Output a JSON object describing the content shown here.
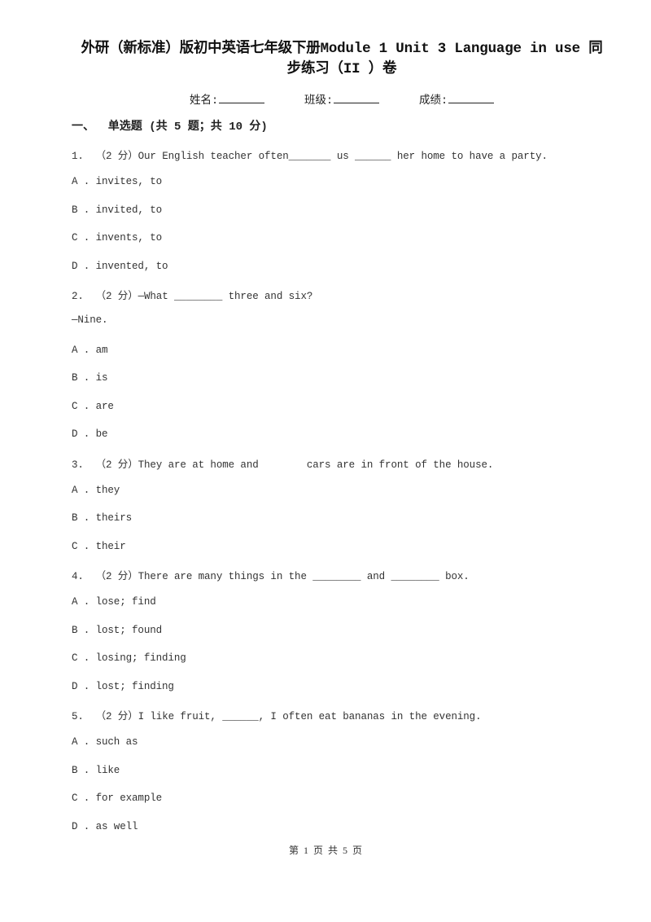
{
  "document": {
    "title_line1": "外研（新标准）版初中英语七年级下册Module 1 Unit 3 Language in use 同",
    "title_line2": "步练习（II ）卷",
    "info": {
      "name_label": "姓名:",
      "class_label": "班级:",
      "score_label": "成绩:"
    },
    "section": {
      "title": "一、  单选题 (共 5 题；共 10 分)"
    },
    "questions": [
      {
        "stem": "1.  （2 分）Our English teacher often_______ us ______ her home to have a party.",
        "options": [
          "A . invites, to",
          "B . invited, to",
          "C . invents, to",
          "D . invented, to"
        ]
      },
      {
        "stem": "2.  （2 分）—What ________ three and six?",
        "extra": "—Nine.",
        "options": [
          "A . am",
          "B . is",
          "C . are",
          "D . be"
        ]
      },
      {
        "stem": "3.  （2 分）They are at home and        cars are in front of the house.",
        "options": [
          "A . they",
          "B . theirs",
          "C . their"
        ]
      },
      {
        "stem": "4.  （2 分）There are many things in the ________ and ________ box.",
        "options": [
          "A . lose; find",
          "B . lost; found",
          "C . losing; finding",
          "D . lost; finding"
        ]
      },
      {
        "stem": "5.  （2 分）I like fruit, ______, I often eat bananas in the evening.",
        "options": [
          "A . such as",
          "B . like",
          "C . for example",
          "D . as well"
        ]
      }
    ],
    "footer": "第 1 页 共 5 页"
  }
}
